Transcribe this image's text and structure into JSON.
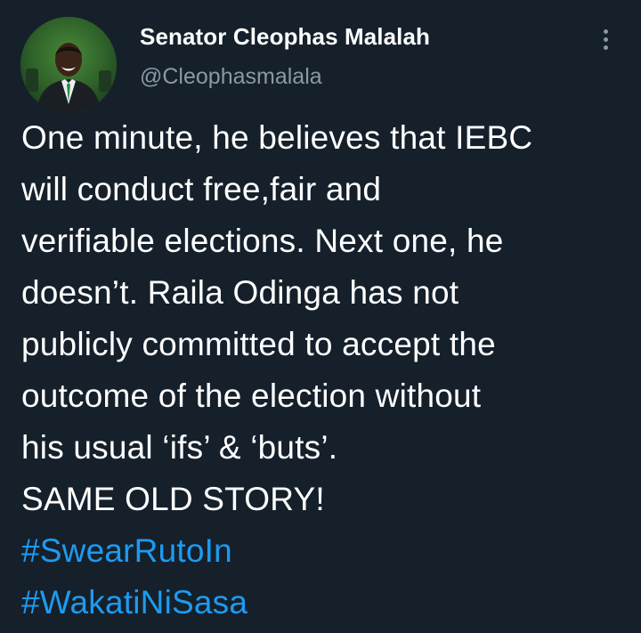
{
  "author": {
    "display_name": "Senator Cleophas Malalah",
    "handle": "@Cleophasmalala"
  },
  "icons": {
    "avatar": "profile-photo",
    "more": "vertical-ellipsis-icon"
  },
  "colors": {
    "background": "#15202b",
    "text": "#ffffff",
    "secondary_text": "#8b98a5",
    "hashtag": "#1d9bf0"
  },
  "tweet": {
    "lines": [
      "One minute, he believes that IEBC",
      "will conduct free,fair and",
      "verifiable elections. Next one, he",
      "doesn’t. Raila Odinga has not",
      "publicly committed to accept the",
      "outcome of the election without",
      "his usual ‘ifs’ & ‘buts’.",
      "SAME OLD STORY!"
    ],
    "hashtags": [
      "#SwearRutoIn",
      "#WakatiNiSasa"
    ]
  }
}
